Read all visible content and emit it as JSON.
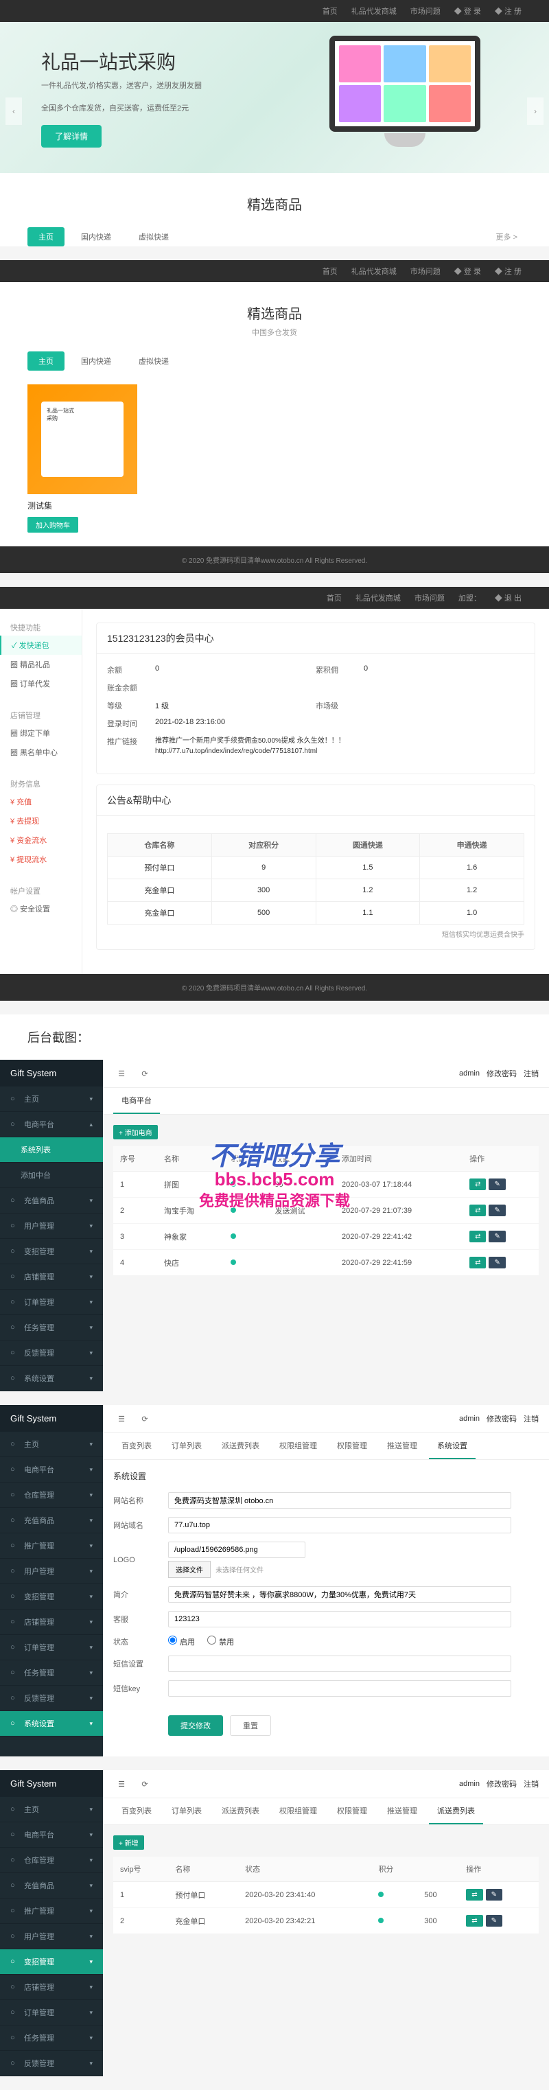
{
  "topnav": {
    "items": [
      "首页",
      "礼品代发商城",
      "市场问题",
      "◆ 登 录",
      "◆ 注 册"
    ]
  },
  "hero": {
    "title": "礼品一站式采购",
    "desc1": "一件礼品代发,价格实惠，送客户，送朋友朋友圈",
    "desc2": "全国多个仓库发货，自买送客，运费低至2元",
    "btn": "了解详情"
  },
  "featured": {
    "title": "精选商品",
    "subtitle": "中国多仓发货",
    "tabs": [
      "主页",
      "国内快递",
      "虚拟快递"
    ],
    "more": "更多 >",
    "product": {
      "name": "测试集",
      "btn": "加入购物车"
    }
  },
  "footer": "© 2020 免费源码项目清单www.otobo.cn All Rights Reserved.",
  "userCenter": {
    "topnav": [
      "首页",
      "礼品代发商城",
      "市场问题",
      "加盟：",
      "◆ 退 出"
    ],
    "phone": "",
    "sidebar": {
      "g1": {
        "title": "快捷功能",
        "items": [
          "✓ 发快递包",
          "圈 精品礼品",
          "圈 订单代发"
        ]
      },
      "g2": {
        "title": "店铺管理",
        "items": [
          "圈 绑定下单",
          "圈 黑名单中心"
        ]
      },
      "g3": {
        "title": "财务信息",
        "items": [
          "¥ 充值",
          "¥ 去提现",
          "¥ 资金流水",
          "¥ 提现流水"
        ]
      },
      "g4": {
        "title": "帐户设置",
        "items": [
          "◎ 安全设置"
        ]
      }
    },
    "panelTitle": "15123123123的会员中心",
    "rows": [
      {
        "l1": "余额",
        "v1": "0",
        "l2": "累积佣",
        "v2": "0"
      },
      {
        "l1": "账金余额",
        "v1": ""
      },
      {
        "l1": "等级",
        "v1": "1 级",
        "l2": "市场级",
        "v2": ""
      },
      {
        "l1": "登录时间",
        "v1": "2021-02-18 23:16:00"
      },
      {
        "l1": "推广链接",
        "v1": "推荐推广一个新用户奖手续费佣金50.00%提成 永久生效！！！"
      }
    ],
    "link": "http://77.u7u.top/index/index/reg/code/77518107.html",
    "helpTitle": "公告&帮助中心",
    "helpTable": {
      "headers": [
        "仓库名称",
        "对应积分",
        "圆通快递",
        "申通快递"
      ],
      "rows": [
        [
          "预付单口",
          "9",
          "1.5",
          "1.6"
        ],
        [
          "充金单口",
          "300",
          "1.2",
          "1.2"
        ],
        [
          "充金单口",
          "500",
          "1.1",
          "1.0"
        ]
      ],
      "note": "短信核实均优惠运费含快手"
    }
  },
  "backend_heading": "后台截图：",
  "watermark": {
    "l1": "不错吧分享",
    "l2": "bbs.bcb5.com",
    "l3": "免费提供精品资源下载"
  },
  "admin": {
    "logo": "Gift System",
    "menu": [
      "主页",
      "电商平台",
      "充值商品",
      "用户管理",
      "变招管理",
      "店铺管理",
      "订单管理",
      "任务管理",
      "反馈管理",
      "系统设置"
    ],
    "submenu": [
      "系统列表",
      "添加中台"
    ],
    "topbar": {
      "admin": "admin",
      "modify": "修改密码",
      "logout": "注销"
    },
    "panel1": {
      "tabs": [
        "电商平台"
      ],
      "toolbar": {
        "add": "+ 添加电商"
      },
      "headers": [
        "序号",
        "名称",
        "状态",
        "权重",
        "添加时间",
        "操作"
      ],
      "rows": [
        {
          "id": "1",
          "name": "拼图",
          "w": "99",
          "time": "2020-03-07 17:18:44"
        },
        {
          "id": "2",
          "name": "淘宝手淘",
          "w": "发送测试",
          "time": "2020-07-29 21:07:39"
        },
        {
          "id": "3",
          "name": "神象家",
          "w": "",
          "time": "2020-07-29 22:41:42"
        },
        {
          "id": "4",
          "name": "快店",
          "w": "",
          "time": "2020-07-29 22:41:59"
        }
      ]
    },
    "panel2": {
      "tabs": [
        "百变列表",
        "订单列表",
        "派送费列表",
        "权限组管理",
        "权限管理",
        "推送管理",
        "系统设置"
      ],
      "active": "系统设置",
      "formTitle": "系统设置",
      "fields": {
        "site_name": {
          "label": "网站名称",
          "value": "免费源码支智慧深圳 otobo.cn"
        },
        "site_url": {
          "label": "网站域名",
          "value": "77.u7u.top"
        },
        "logo": {
          "label": "LOGO",
          "value": "/upload/1596269586.png",
          "btn": "选择文件",
          "hint": "未选择任何文件"
        },
        "desc": {
          "label": "简介",
          "value": "免费源码智慧好赞未来 ，等你赢求8800W，力量30%优惠，免费试用7天"
        },
        "kefu": {
          "label": "客服",
          "value": "123123"
        },
        "status": {
          "label": "状态",
          "opts": [
            "启用",
            "禁用"
          ]
        },
        "note": {
          "label": "短信设置",
          "value": ""
        },
        "remark": {
          "label": "短信key",
          "value": ""
        }
      },
      "submit": "提交修改",
      "reset": "重置"
    },
    "panel3": {
      "tabs": [
        "百变列表",
        "订单列表",
        "派送费列表",
        "权限组管理",
        "权限管理",
        "推送管理",
        "系统设置"
      ],
      "active": "派送费列表",
      "search": {
        "addBtn": "+ 新增"
      },
      "headers": [
        "svip号",
        "名称",
        "状态",
        "积分",
        "",
        "操作"
      ],
      "rows": [
        {
          "id": "1",
          "name": "预付单口",
          "time": "2020-03-20 23:41:40",
          "pts": "500"
        },
        {
          "id": "2",
          "name": "充金单口",
          "time": "2020-03-20 23:42:21",
          "pts": "300"
        }
      ]
    }
  },
  "admin_menu2": [
    "主页",
    "电商平台",
    "仓库管理",
    "充值商品",
    "推广管理",
    "用户管理",
    "变招管理",
    "店铺管理",
    "订单管理",
    "任务管理",
    "反馈管理",
    "系统设置"
  ],
  "admin_menu3": [
    "主页",
    "电商平台",
    "仓库管理",
    "充值商品",
    "推广管理",
    "用户管理",
    "变招管理",
    "店铺管理",
    "订单管理",
    "任务管理",
    "反馈管理"
  ]
}
